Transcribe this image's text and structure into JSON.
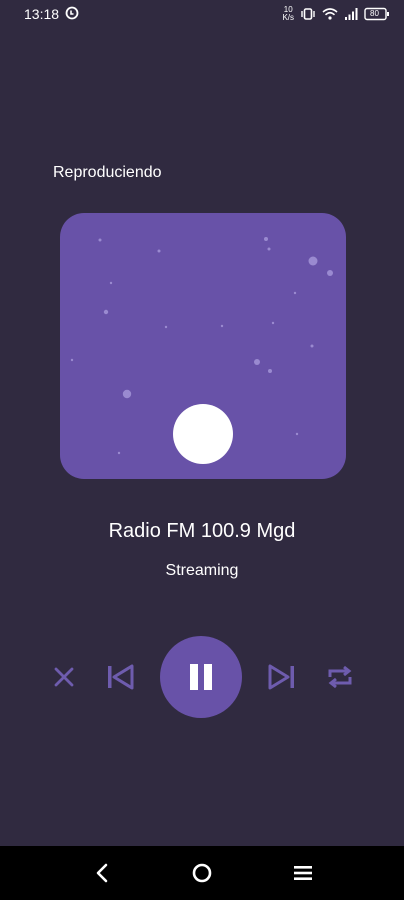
{
  "status_bar": {
    "time": "13:18",
    "network_speed_top": "10",
    "network_speed_bottom": "K/s",
    "battery": "80"
  },
  "player": {
    "now_playing_label": "Reproduciendo",
    "station_title": "Radio FM 100.9 Mgd",
    "station_subtitle": "Streaming",
    "state": "playing"
  },
  "controls": {
    "shuffle_icon": "shuffle-icon",
    "previous_icon": "skip-previous-icon",
    "play_pause_icon": "pause-icon",
    "next_icon": "skip-next-icon",
    "repeat_icon": "repeat-icon"
  },
  "navigation": {
    "back_icon": "back-icon",
    "home_icon": "home-icon",
    "recents_icon": "menu-icon"
  },
  "colors": {
    "background": "#302a40",
    "accent": "#6852a8",
    "control_inactive": "#6e5cae",
    "text": "#ffffff",
    "nav_bar": "#000000"
  }
}
